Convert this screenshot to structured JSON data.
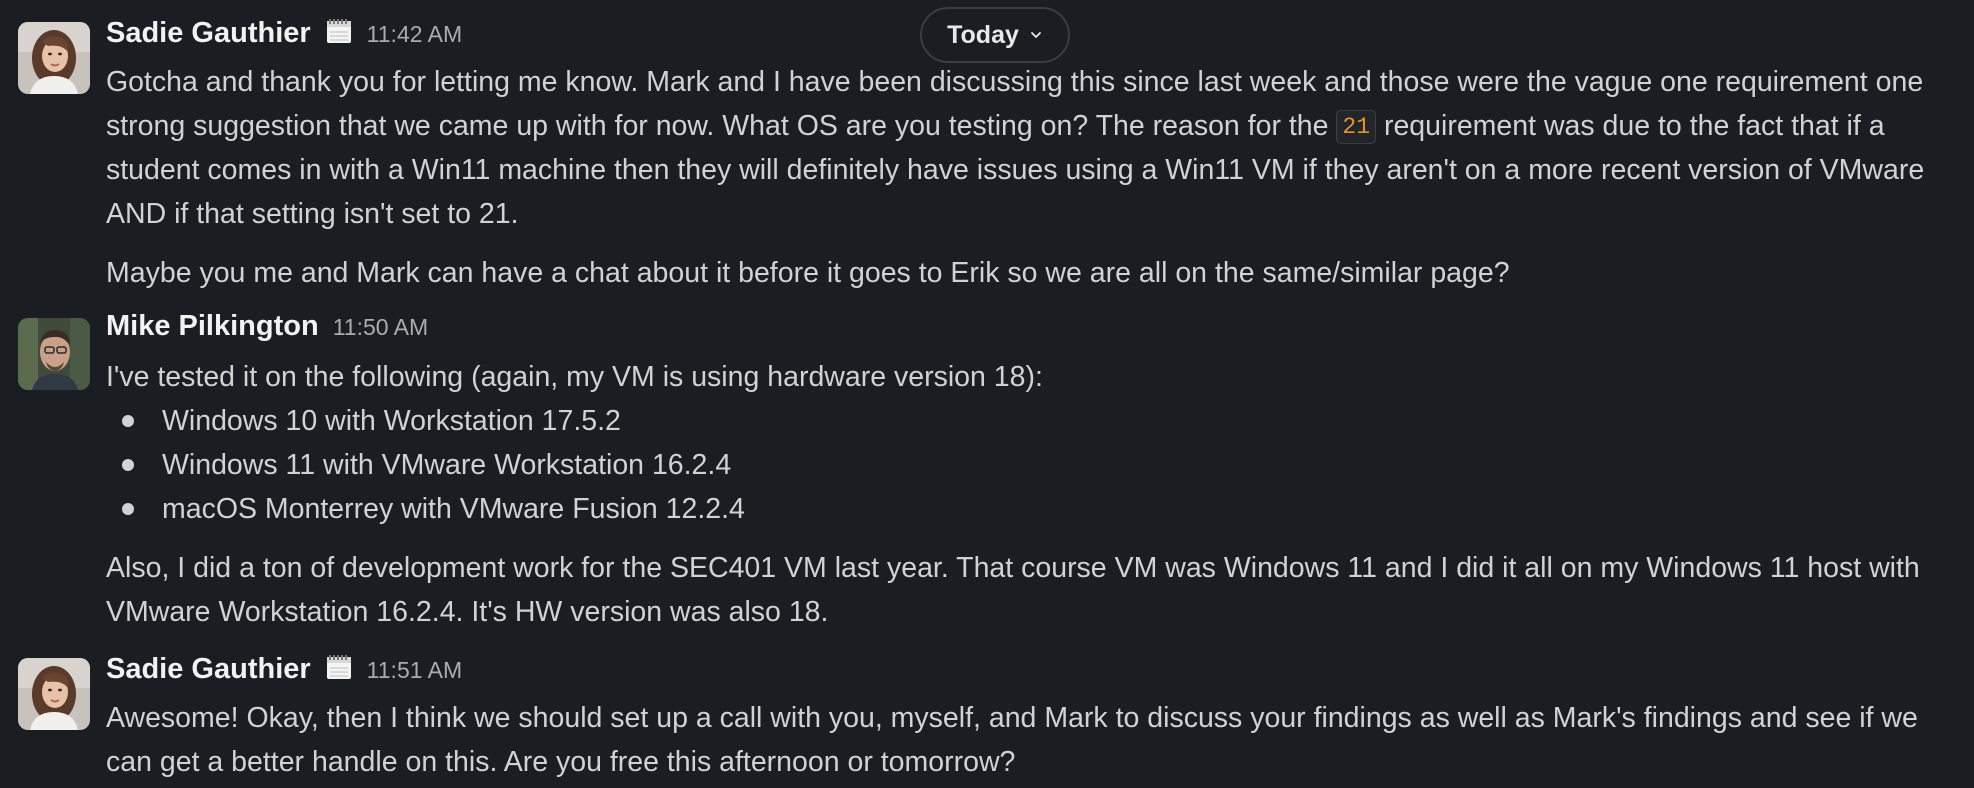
{
  "day_divider": {
    "label": "Today",
    "icon": "chevron-down-icon"
  },
  "messages": [
    {
      "author": "Sadie Gauthier",
      "status_emoji": "calendar-icon",
      "time": "11:42 AM",
      "para1_a": "Gotcha and thank you for letting me know. Mark and I have been discussing this since last week and those were the vague one requirement one strong suggestion that we came up with for now. What OS are you testing on? The reason for the ",
      "para1_code": "21",
      "para1_b": " requirement was due to the fact that if a student comes in with a Win11 machine then they will definitely have issues using a Win11 VM if they aren't on a more recent version of VMware AND if that setting isn't set to 21.",
      "para2": "Maybe you me and Mark can have a chat about it before it goes to Erik so we are all on the same/similar page?"
    },
    {
      "author": "Mike Pilkington",
      "time": "11:50 AM",
      "intro": "I've tested it on the following (again, my VM is using hardware version 18):",
      "bullets": [
        "Windows 10 with Workstation 17.5.2",
        "Windows 11 with VMware Workstation 16.2.4",
        "macOS Monterrey with VMware Fusion 12.2.4"
      ],
      "para2": " Also, I did a ton of development work for the SEC401 VM last year. That course VM was Windows 11 and I did it all on my Windows 11 host with VMware Workstation 16.2.4. It's HW version was also 18."
    },
    {
      "author": "Sadie Gauthier",
      "status_emoji": "calendar-icon",
      "time": "11:51 AM",
      "para1": "Awesome! Okay, then I think we should set up a call with you, myself, and Mark to discuss your findings as well as Mark's findings and see if we can get a better handle on this. Are you free this afternoon or tomorrow?"
    }
  ],
  "colors": {
    "background": "#1a1d21",
    "text": "#d1d2d3",
    "author": "#f2f2f2",
    "timestamp": "#ababad",
    "code_text": "#e8912d"
  }
}
